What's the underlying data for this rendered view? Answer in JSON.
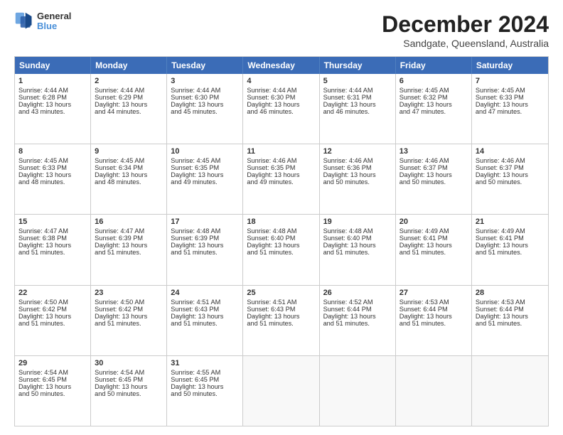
{
  "header": {
    "logo_line1": "General",
    "logo_line2": "Blue",
    "main_title": "December 2024",
    "subtitle": "Sandgate, Queensland, Australia"
  },
  "weekdays": [
    "Sunday",
    "Monday",
    "Tuesday",
    "Wednesday",
    "Thursday",
    "Friday",
    "Saturday"
  ],
  "weeks": [
    [
      {
        "day": "1",
        "lines": [
          "Sunrise: 4:44 AM",
          "Sunset: 6:28 PM",
          "Daylight: 13 hours",
          "and 43 minutes."
        ]
      },
      {
        "day": "2",
        "lines": [
          "Sunrise: 4:44 AM",
          "Sunset: 6:29 PM",
          "Daylight: 13 hours",
          "and 44 minutes."
        ]
      },
      {
        "day": "3",
        "lines": [
          "Sunrise: 4:44 AM",
          "Sunset: 6:30 PM",
          "Daylight: 13 hours",
          "and 45 minutes."
        ]
      },
      {
        "day": "4",
        "lines": [
          "Sunrise: 4:44 AM",
          "Sunset: 6:30 PM",
          "Daylight: 13 hours",
          "and 46 minutes."
        ]
      },
      {
        "day": "5",
        "lines": [
          "Sunrise: 4:44 AM",
          "Sunset: 6:31 PM",
          "Daylight: 13 hours",
          "and 46 minutes."
        ]
      },
      {
        "day": "6",
        "lines": [
          "Sunrise: 4:45 AM",
          "Sunset: 6:32 PM",
          "Daylight: 13 hours",
          "and 47 minutes."
        ]
      },
      {
        "day": "7",
        "lines": [
          "Sunrise: 4:45 AM",
          "Sunset: 6:33 PM",
          "Daylight: 13 hours",
          "and 47 minutes."
        ]
      }
    ],
    [
      {
        "day": "8",
        "lines": [
          "Sunrise: 4:45 AM",
          "Sunset: 6:33 PM",
          "Daylight: 13 hours",
          "and 48 minutes."
        ]
      },
      {
        "day": "9",
        "lines": [
          "Sunrise: 4:45 AM",
          "Sunset: 6:34 PM",
          "Daylight: 13 hours",
          "and 48 minutes."
        ]
      },
      {
        "day": "10",
        "lines": [
          "Sunrise: 4:45 AM",
          "Sunset: 6:35 PM",
          "Daylight: 13 hours",
          "and 49 minutes."
        ]
      },
      {
        "day": "11",
        "lines": [
          "Sunrise: 4:46 AM",
          "Sunset: 6:35 PM",
          "Daylight: 13 hours",
          "and 49 minutes."
        ]
      },
      {
        "day": "12",
        "lines": [
          "Sunrise: 4:46 AM",
          "Sunset: 6:36 PM",
          "Daylight: 13 hours",
          "and 50 minutes."
        ]
      },
      {
        "day": "13",
        "lines": [
          "Sunrise: 4:46 AM",
          "Sunset: 6:37 PM",
          "Daylight: 13 hours",
          "and 50 minutes."
        ]
      },
      {
        "day": "14",
        "lines": [
          "Sunrise: 4:46 AM",
          "Sunset: 6:37 PM",
          "Daylight: 13 hours",
          "and 50 minutes."
        ]
      }
    ],
    [
      {
        "day": "15",
        "lines": [
          "Sunrise: 4:47 AM",
          "Sunset: 6:38 PM",
          "Daylight: 13 hours",
          "and 51 minutes."
        ]
      },
      {
        "day": "16",
        "lines": [
          "Sunrise: 4:47 AM",
          "Sunset: 6:39 PM",
          "Daylight: 13 hours",
          "and 51 minutes."
        ]
      },
      {
        "day": "17",
        "lines": [
          "Sunrise: 4:48 AM",
          "Sunset: 6:39 PM",
          "Daylight: 13 hours",
          "and 51 minutes."
        ]
      },
      {
        "day": "18",
        "lines": [
          "Sunrise: 4:48 AM",
          "Sunset: 6:40 PM",
          "Daylight: 13 hours",
          "and 51 minutes."
        ]
      },
      {
        "day": "19",
        "lines": [
          "Sunrise: 4:48 AM",
          "Sunset: 6:40 PM",
          "Daylight: 13 hours",
          "and 51 minutes."
        ]
      },
      {
        "day": "20",
        "lines": [
          "Sunrise: 4:49 AM",
          "Sunset: 6:41 PM",
          "Daylight: 13 hours",
          "and 51 minutes."
        ]
      },
      {
        "day": "21",
        "lines": [
          "Sunrise: 4:49 AM",
          "Sunset: 6:41 PM",
          "Daylight: 13 hours",
          "and 51 minutes."
        ]
      }
    ],
    [
      {
        "day": "22",
        "lines": [
          "Sunrise: 4:50 AM",
          "Sunset: 6:42 PM",
          "Daylight: 13 hours",
          "and 51 minutes."
        ]
      },
      {
        "day": "23",
        "lines": [
          "Sunrise: 4:50 AM",
          "Sunset: 6:42 PM",
          "Daylight: 13 hours",
          "and 51 minutes."
        ]
      },
      {
        "day": "24",
        "lines": [
          "Sunrise: 4:51 AM",
          "Sunset: 6:43 PM",
          "Daylight: 13 hours",
          "and 51 minutes."
        ]
      },
      {
        "day": "25",
        "lines": [
          "Sunrise: 4:51 AM",
          "Sunset: 6:43 PM",
          "Daylight: 13 hours",
          "and 51 minutes."
        ]
      },
      {
        "day": "26",
        "lines": [
          "Sunrise: 4:52 AM",
          "Sunset: 6:44 PM",
          "Daylight: 13 hours",
          "and 51 minutes."
        ]
      },
      {
        "day": "27",
        "lines": [
          "Sunrise: 4:53 AM",
          "Sunset: 6:44 PM",
          "Daylight: 13 hours",
          "and 51 minutes."
        ]
      },
      {
        "day": "28",
        "lines": [
          "Sunrise: 4:53 AM",
          "Sunset: 6:44 PM",
          "Daylight: 13 hours",
          "and 51 minutes."
        ]
      }
    ],
    [
      {
        "day": "29",
        "lines": [
          "Sunrise: 4:54 AM",
          "Sunset: 6:45 PM",
          "Daylight: 13 hours",
          "and 50 minutes."
        ]
      },
      {
        "day": "30",
        "lines": [
          "Sunrise: 4:54 AM",
          "Sunset: 6:45 PM",
          "Daylight: 13 hours",
          "and 50 minutes."
        ]
      },
      {
        "day": "31",
        "lines": [
          "Sunrise: 4:55 AM",
          "Sunset: 6:45 PM",
          "Daylight: 13 hours",
          "and 50 minutes."
        ]
      },
      {
        "day": "",
        "lines": []
      },
      {
        "day": "",
        "lines": []
      },
      {
        "day": "",
        "lines": []
      },
      {
        "day": "",
        "lines": []
      }
    ]
  ]
}
